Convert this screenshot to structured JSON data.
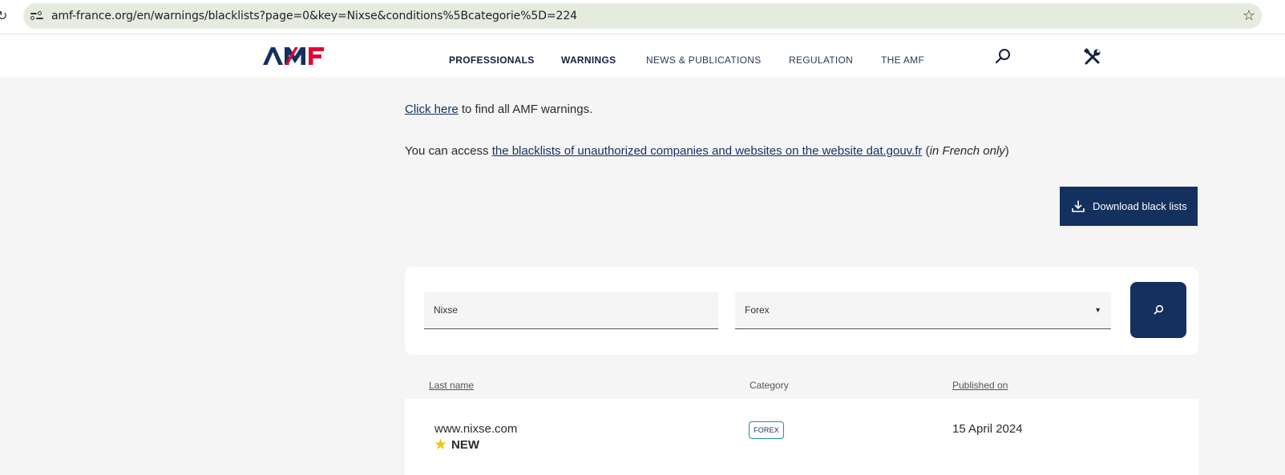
{
  "browser": {
    "url": "amf-france.org/en/warnings/blacklists?page=0&key=Nixse&conditions%5Bcategorie%5D=224"
  },
  "header": {
    "logo_text": "AMF",
    "nav": [
      "PROFESSIONALS",
      "WARNINGS",
      "NEWS & PUBLICATIONS",
      "REGULATION",
      "THE AMF"
    ]
  },
  "intro": {
    "click_here": "Click here",
    "click_here_rest": " to find all AMF warnings.",
    "access_prefix": "You can access ",
    "access_link": "the blacklists of unauthorized companies and websites on the website dat.gouv.fr",
    "access_open": " (",
    "access_italic": "in French only",
    "access_close": ")"
  },
  "download_button": "Download black lists",
  "search": {
    "key_value": "Nixse",
    "category_value": "Forex"
  },
  "table": {
    "headers": [
      "Last name",
      "Category",
      "Published on"
    ],
    "rows": [
      {
        "name": "www.nixse.com",
        "new_label": "NEW",
        "category": "FOREX",
        "published": "15 April 2024"
      }
    ]
  },
  "colors": {
    "primary": "#14305e",
    "logo_red": "#e4003a",
    "new_star": "#f1c40f",
    "badge_border": "#1e8fa0"
  }
}
